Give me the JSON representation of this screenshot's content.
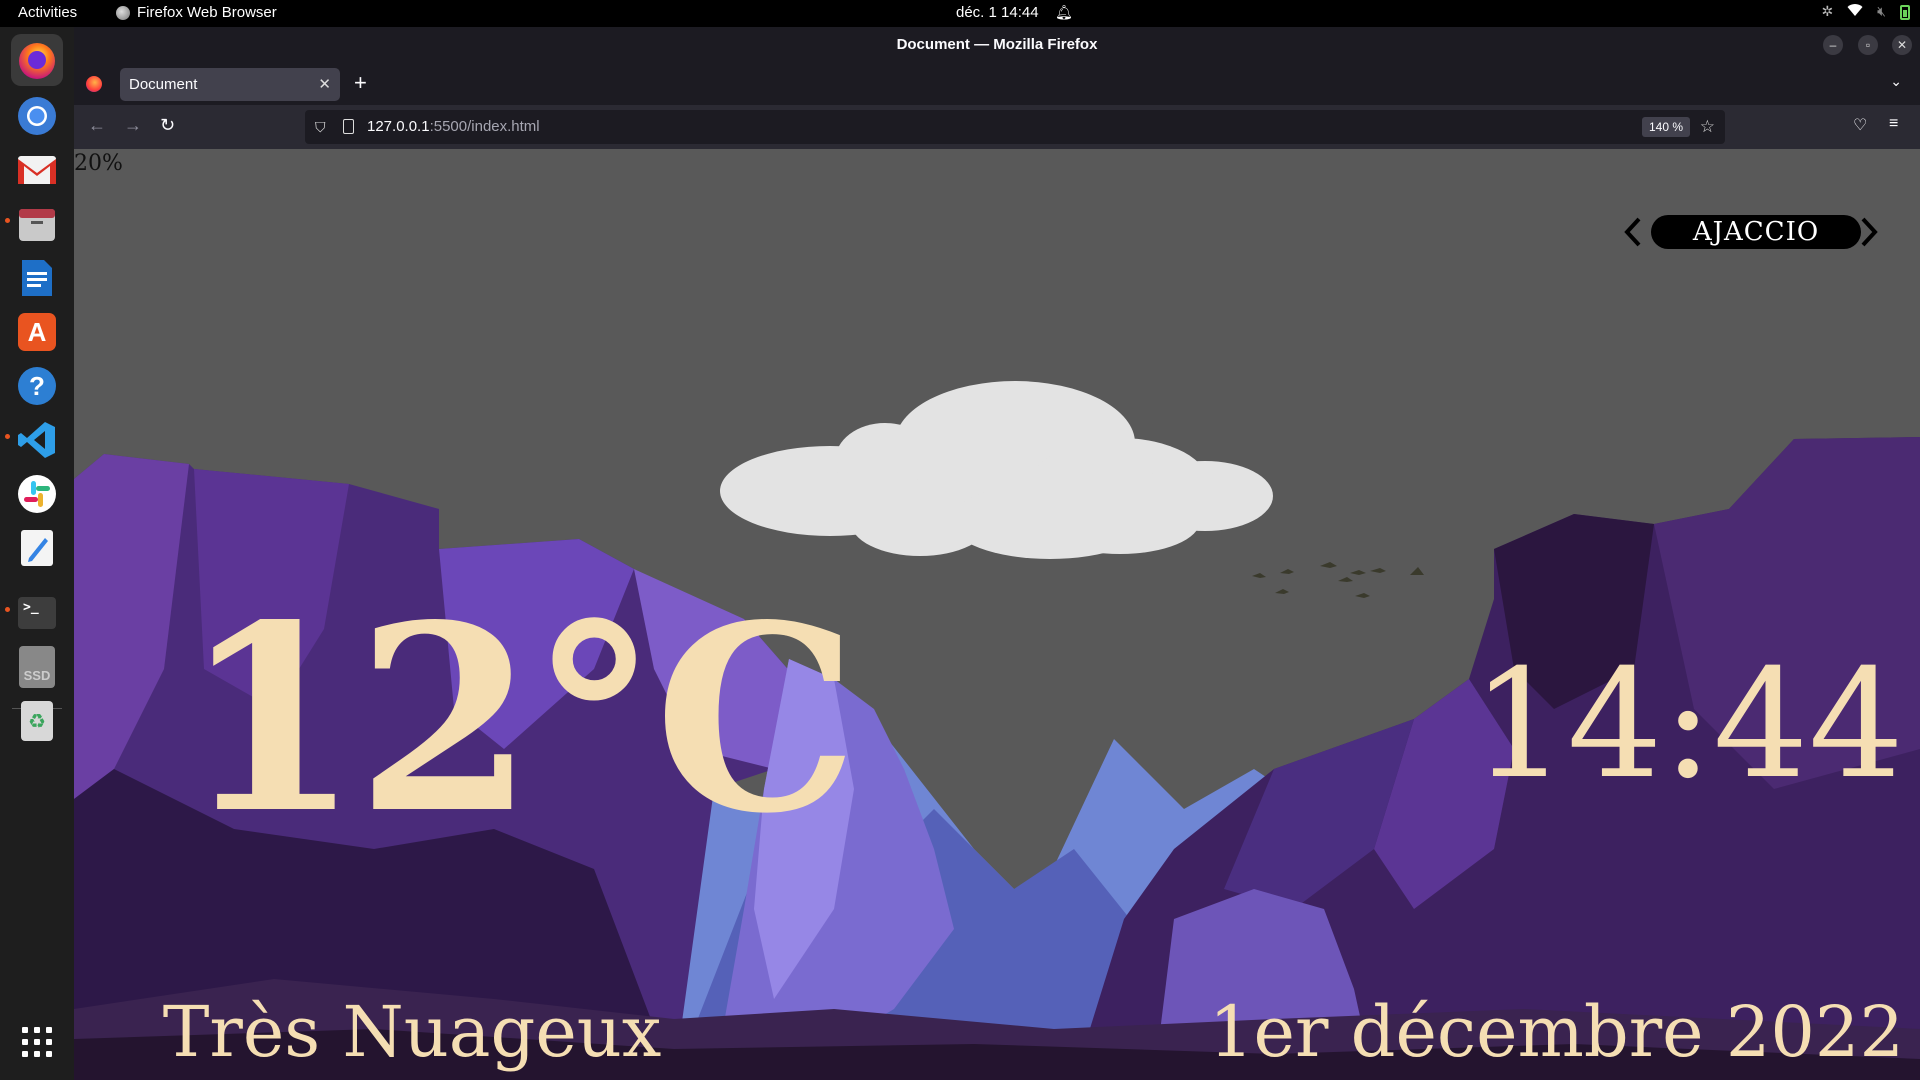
{
  "system": {
    "activities_label": "Activities",
    "app_name": "Firefox Web Browser",
    "clock": "déc. 1  14:44"
  },
  "dock": {
    "apps": [
      "firefox-icon",
      "chromium-icon",
      "gmail-icon",
      "files-icon",
      "writer-icon",
      "app-center-icon",
      "help-icon",
      "vscode-icon",
      "slack-icon",
      "text-editor-icon",
      "terminal-icon",
      "ssd-drive-icon",
      "trash-icon"
    ],
    "ssd_label": "SSD"
  },
  "browser": {
    "window_title": "Document — Mozilla Firefox",
    "tab_title": "Document",
    "url_host": "127.0.0.1",
    "url_rest": ":5500/index.html",
    "zoom": "140 %"
  },
  "weather": {
    "progress_text": "20%",
    "city": "AJACCIO",
    "temperature": "12°C",
    "time": "14:44",
    "description": "Très Nuageux",
    "date": "1er décembre 2022"
  },
  "colors": {
    "sky": "#595959",
    "text": "#f5deb3",
    "cloud": "#e3e3e3"
  }
}
